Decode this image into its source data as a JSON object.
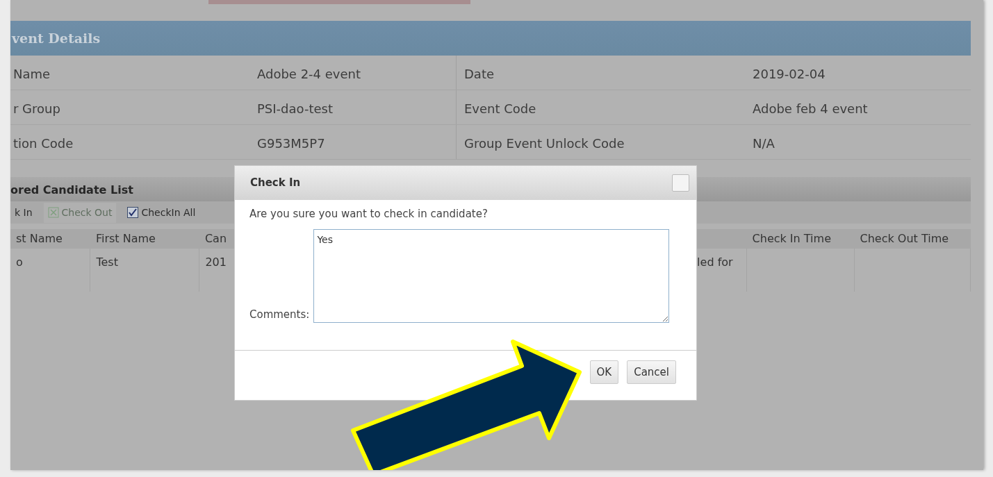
{
  "section_title": "vent Details",
  "details": [
    {
      "label": "Name",
      "value": "Adobe 2-4 event",
      "label_2": "Date",
      "value_2": "2019-02-04"
    },
    {
      "label": "r Group",
      "value": "PSI-dao-test",
      "label_2": "Event Code",
      "value_2": "Adobe feb 4 event"
    },
    {
      "label": "tion Code",
      "value": "G953M5P7",
      "label_2": "Group Event Unlock Code",
      "value_2": "N/A"
    }
  ],
  "candidate_list": {
    "title": "ored Candidate List",
    "toolbar": [
      {
        "kind": "button",
        "label": "k In",
        "disabled": false
      },
      {
        "kind": "button",
        "label": "Check Out",
        "disabled": true
      },
      {
        "kind": "checkbox",
        "label": "CheckIn All",
        "checked": true
      }
    ],
    "columns": [
      "st Name",
      "First Name",
      "Can",
      "Check In Time",
      "Check Out Time"
    ],
    "rows": [
      {
        "column_1": "o",
        "first_name": "Test",
        "column_3": "201",
        "column_4": "led for"
      }
    ]
  },
  "dialog": {
    "title": "Check In",
    "message": "Are you sure you want to check in candidate?",
    "comments_label": "Comments:",
    "comments_value": "Yes ",
    "buttons": [
      "OK",
      "Cancel"
    ]
  }
}
